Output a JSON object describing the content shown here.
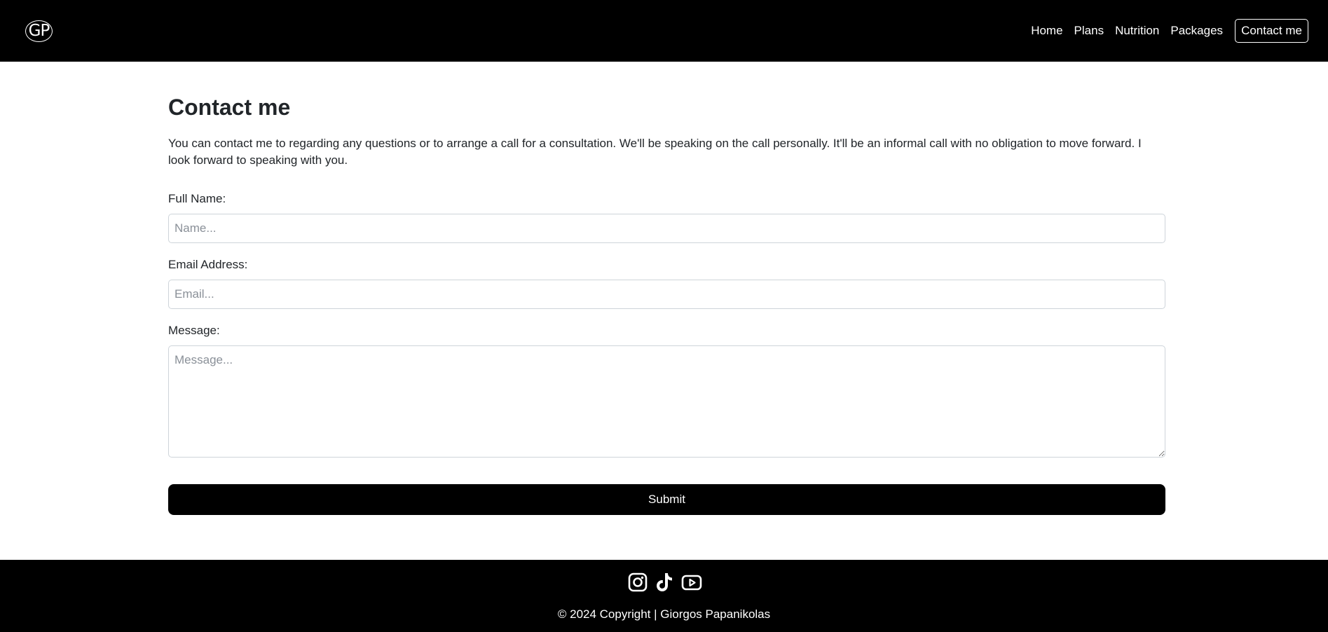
{
  "header": {
    "logo_text": "GP",
    "nav": {
      "home": "Home",
      "plans": "Plans",
      "nutrition": "Nutrition",
      "packages": "Packages",
      "contact": "Contact me"
    }
  },
  "main": {
    "title": "Contact me",
    "intro": "You can contact me to regarding any questions or to arrange a call for a consultation. We'll be speaking on the call personally. It'll be an informal call with no obligation to move forward. I look forward to speaking with you.",
    "form": {
      "name_label": "Full Name:",
      "name_placeholder": "Name...",
      "email_label": "Email Address:",
      "email_placeholder": "Email...",
      "message_label": "Message:",
      "message_placeholder": "Message...",
      "submit_label": "Submit"
    }
  },
  "footer": {
    "social_icons": [
      "instagram-icon",
      "tiktok-icon",
      "youtube-icon"
    ],
    "copyright": "© 2024 Copyright | Giorgos Papanikolas"
  },
  "colors": {
    "header_bg": "#000000",
    "footer_bg": "#000000",
    "button_bg": "#000000",
    "text": "#212529"
  }
}
